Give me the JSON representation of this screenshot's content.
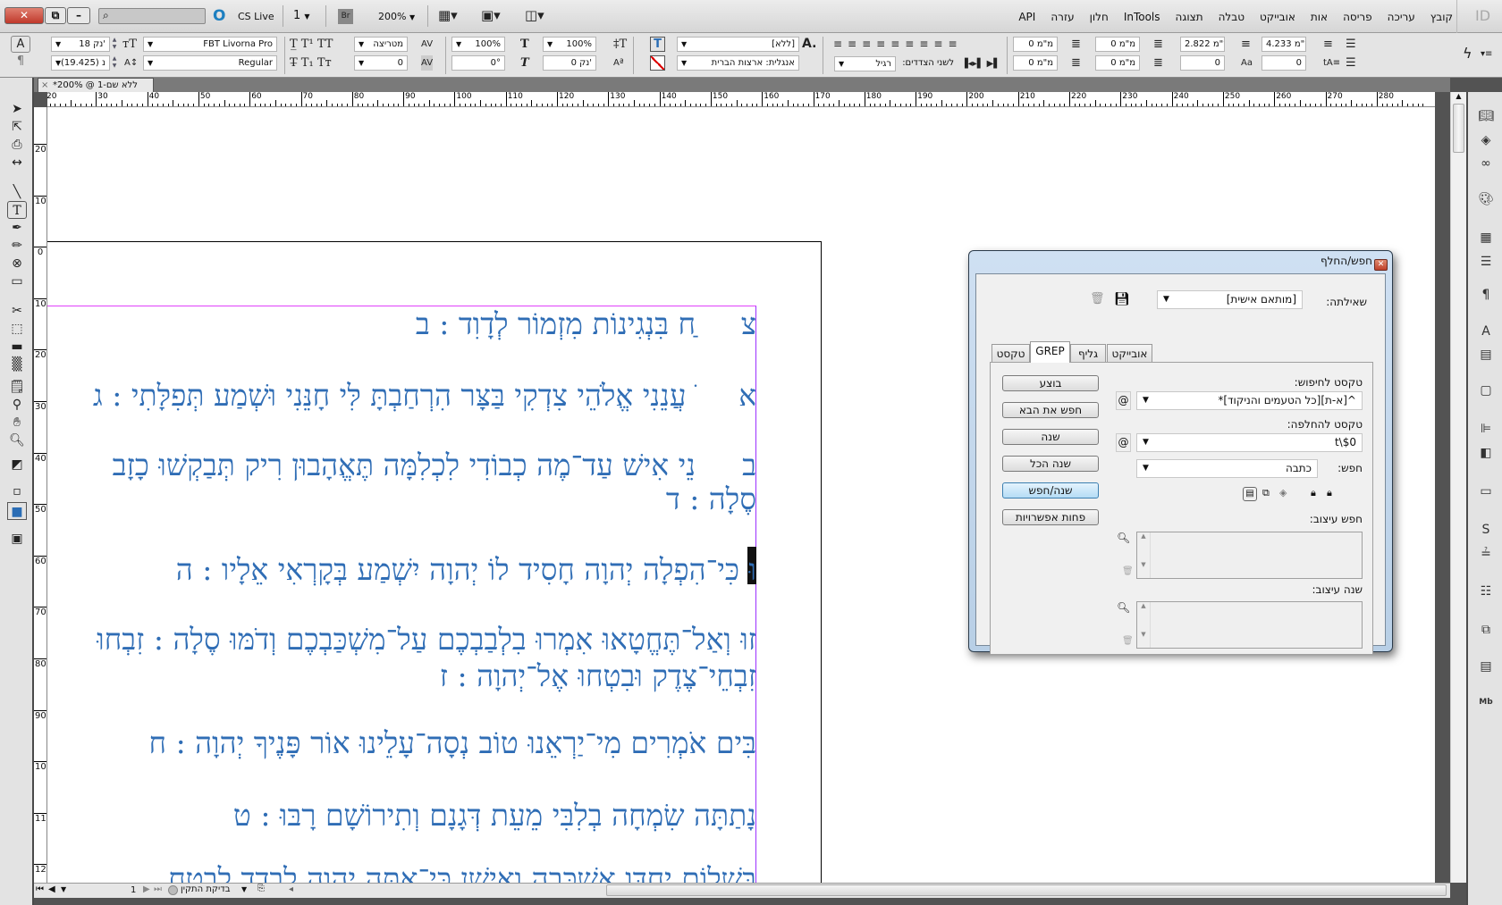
{
  "appbar": {
    "search_placeholder": "",
    "cs_live": "CS Live",
    "page_num": "1",
    "bridge": "Br",
    "zoom": "200%",
    "menu": [
      "קובץ",
      "עריכה",
      "פריסה",
      "אות",
      "אובייקט",
      "טבלה",
      "תצוגה",
      "InTools",
      "חלון",
      "עזרה",
      "API"
    ],
    "logo": "ID"
  },
  "control": {
    "font_size": "18 נק'",
    "leading": "(19.425) נ",
    "font_family": "FBT Livorna Pro",
    "font_style": "Regular",
    "kerning": "מטריצה",
    "tracking": "0",
    "vscale": "100%",
    "skew": "0°",
    "hscale": "100%",
    "baseline": "0 נק'",
    "char_style": "[ללא]",
    "language": "אנגלית: ארצות הברית",
    "justify_label": "לשני הצדדים:",
    "justify_value": "רגיל",
    "indent_left": "0 מ\"מ",
    "indent_first": "0 מ\"מ",
    "indent_right": "0 מ\"מ",
    "indent_last": "0 מ\"מ",
    "space_before": "2.822 מ\"מ",
    "drop_lines": "0",
    "space_after": "4.233 מ\"מ",
    "drop_chars": "0"
  },
  "doc_tab": "*200% @ 1-ללא שם",
  "rulers": {
    "h": [
      "20",
      "30",
      "40",
      "50",
      "60",
      "70",
      "80",
      "90",
      "100",
      "110",
      "120",
      "130",
      "140",
      "150",
      "160",
      "170",
      "180",
      "190",
      "200",
      "210",
      "220",
      "230",
      "240",
      "250",
      "260",
      "270",
      "280"
    ],
    "v": [
      "20",
      "10",
      "0",
      "10",
      "20",
      "30",
      "40",
      "50",
      "60",
      "70",
      "80",
      "90",
      "100",
      "110",
      "120"
    ]
  },
  "document": {
    "paragraphs": [
      {
        "label": "צ",
        "lines": [
          "ַח בִּנְגִינוֹת מִזְמוֹר לְדָוִד : ב"
        ]
      },
      {
        "label": "א",
        "lines": [
          "ׂ עֲנֵנִי אֱלֹהֵי צִדְקִי בַּצָּר הִרְחַבְתָּ לִּי חָנֵּנִי וּשְׁמַע תְּפִלָּתִי : ג"
        ]
      },
      {
        "label": "ב",
        "lines": [
          "נֵי אִישׁ עַד־מֶה כְבוֹדִי לִכְלִמָּה תֶּאֱהָבוּן רִיק תְּבַקְשׁוּ כָזָב",
          "סֶלָה : ד"
        ]
      },
      {
        "label": "",
        "lines": [
          "וּ כִּי־הִפְלָה יְהוָה חָסִיד לוֹ יְהוָה יִשְׁמַע בְּקָרְאִי אֵלָיו : ה"
        ]
      },
      {
        "label": "",
        "lines": [
          "זוּ וְאַל־תֶּחֱטָאוּ אִמְרוּ בִלְבַבְכֶם עַל־מִשְׁכַּבְכֶם וְדֹמּוּ סֶלָה : זִבְחוּ",
          "זִבְחֵי־צֶדֶק וּבִטְחוּ אֶל־יְהוָה : ז"
        ]
      },
      {
        "label": "",
        "lines": [
          "בִּים אֹמְרִים מִי־יַרְאֵנוּ טוֹב נְסָה־עָלֵינוּ אוֹר פָּנֶיךָ יְהוָה : ח"
        ]
      },
      {
        "label": "",
        "lines": [
          "נָתַתָּה שִׂמְחָה בְלִבִּי מֵעֵת דְּגָנָם וְתִירוֹשָׁם רָבּוּ : ט"
        ]
      },
      {
        "label": "",
        "lines": [
          "בְּשָׁלוֹם יַחְדָּו אֶשְׁכְּבָה וְאִישָׁן כִּי־אַתָּה יְהוָה לְבָדָד לָבֶטַח"
        ]
      }
    ],
    "text_color": "#2f6db5"
  },
  "status": {
    "page": "1",
    "preflight": "בדיקת התקין"
  },
  "dialog": {
    "title": "חפש/החלף",
    "query_label": "שאילתה:",
    "query_value": "[מותאם אישית]",
    "tabs": [
      "טקסט",
      "GREP",
      "גליף",
      "אובייקט"
    ],
    "active_tab": "GREP",
    "find_label": "טקסט לחיפוש:",
    "find_value": "^[א-ת][כל הטעמים והניקוד]*",
    "change_label": "טקסט להחלפה:",
    "change_value": "t\\$0",
    "search_label": "חפש:",
    "search_value": "כתבה",
    "find_format_label": "חפש עיצוב:",
    "change_format_label": "שנה עיצוב:",
    "buttons": [
      "בוצע",
      "חפש את הבא",
      "שנה",
      "שנה הכל",
      "שנה/חפש",
      "פחות אפשרויות"
    ]
  }
}
